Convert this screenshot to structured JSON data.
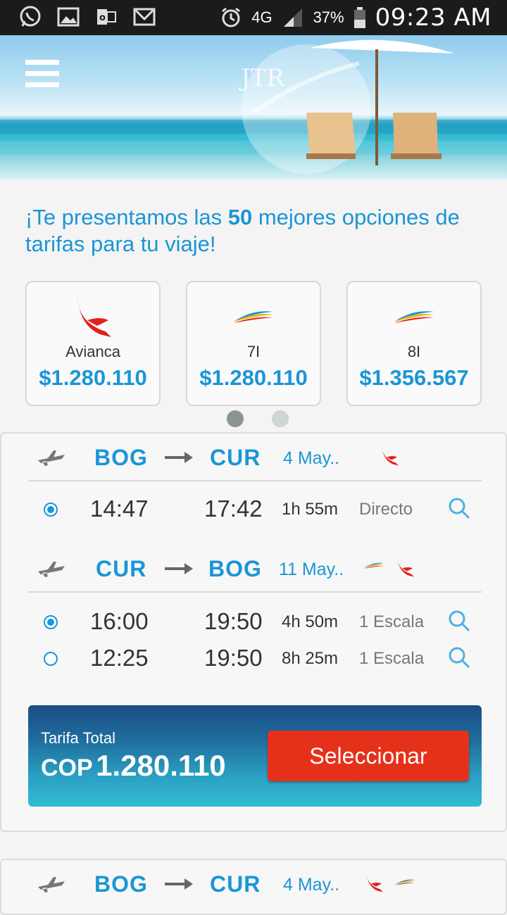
{
  "status_bar": {
    "battery": "37%",
    "network": "4G",
    "time": "09:23 AM"
  },
  "headline": {
    "prefix": "¡Te presentamos las ",
    "count": "50",
    "suffix": " mejores opciones de tarifas para tu viaje!"
  },
  "airline_cards": [
    {
      "name": "Avianca",
      "price": "$1.280.110",
      "logo": "avianca-logo"
    },
    {
      "name": "7I",
      "price": "$1.280.110",
      "logo": "insel-air-logo"
    },
    {
      "name": "8I",
      "price": "$1.356.567",
      "logo": "insel-air-logo"
    }
  ],
  "carousel": {
    "pages": 2,
    "active": 1
  },
  "results": [
    {
      "outbound": {
        "from": "BOG",
        "to": "CUR",
        "date": "4 May..",
        "flights": [
          {
            "dep": "14:47",
            "arr": "17:42",
            "duration": "1h 55m",
            "stops": "Directo",
            "selected": true
          }
        ]
      },
      "return": {
        "from": "CUR",
        "to": "BOG",
        "date": "11 May..",
        "flights": [
          {
            "dep": "16:00",
            "arr": "19:50",
            "duration": "4h 50m",
            "stops": "1 Escala",
            "selected": true
          },
          {
            "dep": "12:25",
            "arr": "19:50",
            "duration": "8h 25m",
            "stops": "1 Escala",
            "selected": false
          }
        ]
      },
      "total_label": "Tarifa Total",
      "currency": "COP",
      "total": "1.280.110",
      "select_label": "Seleccionar"
    },
    {
      "outbound": {
        "from": "BOG",
        "to": "CUR",
        "date": "4 May.."
      }
    }
  ],
  "colors": {
    "accent": "#1a96d6",
    "select_button": "#e5311a",
    "avianca_red": "#e3201b"
  }
}
